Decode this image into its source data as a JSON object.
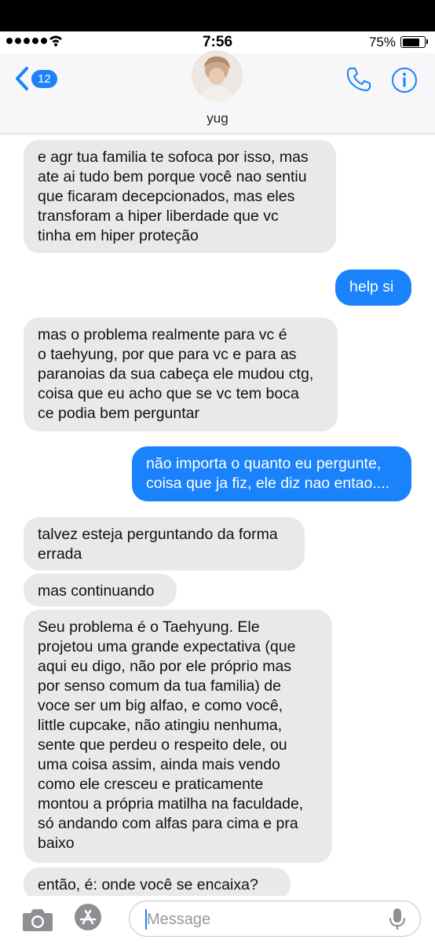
{
  "status_bar": {
    "time": "7:56",
    "battery": "75%"
  },
  "nav": {
    "back_count": "12",
    "contact_name": "yug"
  },
  "messages": [
    {
      "dir": "in",
      "text": "e agr tua familia te sofoca por isso, mas\nate ai tudo bem porque você nao sentiu\nque ficaram decepcionados, mas eles\ntransforam a hiper liberdade que vc\ntinha em hiper proteção"
    },
    {
      "dir": "out",
      "text": "help si"
    },
    {
      "dir": "in",
      "text": "mas o problema realmente para vc é\no taehyung, por que para vc e para as\nparanoias da sua cabeça ele mudou ctg,\ncoisa que eu acho que se vc tem boca\nce podia bem perguntar"
    },
    {
      "dir": "out",
      "text": "não importa o quanto eu pergunte,\ncoisa que ja fiz, ele diz nao entao...."
    },
    {
      "dir": "in",
      "text": "talvez esteja perguntando da forma\nerrada"
    },
    {
      "dir": "in",
      "text": "mas continuando"
    },
    {
      "dir": "in",
      "text": "Seu problema é o Taehyung. Ele\nprojetou uma grande expectativa (que\naqui eu digo, não por ele próprio mas\npor senso comum da tua familia) de\nvoce ser um big alfao, e como você,\nlittle cupcake, não atingiu nenhuma,\nsente que perdeu o respeito dele, ou\numa coisa assim, ainda mais vendo\ncomo ele cresceu e  praticamente\nmontou a própria matilha na faculdade,\nsó andando com alfas para cima e pra\nbaixo"
    },
    {
      "dir": "in",
      "text": "então, é: onde você se encaixa?"
    }
  ],
  "composer": {
    "placeholder": "Message"
  },
  "colors": {
    "accent": "#1a82fb",
    "incoming": "#e9e9eb"
  },
  "icons": [
    "back-chevron-icon",
    "phone-icon",
    "info-icon",
    "camera-icon",
    "app-store-icon",
    "microphone-icon"
  ]
}
